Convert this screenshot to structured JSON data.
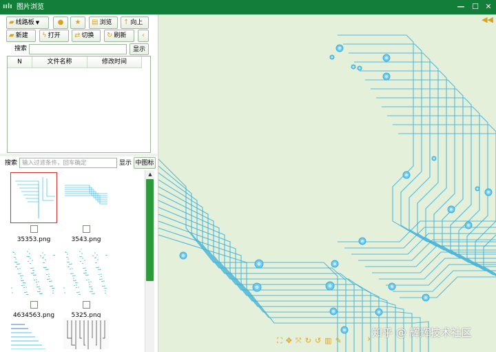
{
  "window": {
    "title": "图片浏览",
    "app_icon": "chart-bars-icon",
    "buttons": {
      "minimize": "—",
      "maximize": "☐",
      "close": "✕"
    },
    "colors": {
      "titlebar": "#137d3a",
      "viewer_bg": "#e5f0da",
      "accent": "#d9a21b",
      "circuit": "#3aaed8"
    }
  },
  "toolbar": {
    "folder_label": "线路板",
    "browse_label": "浏览",
    "up_label": "向上",
    "new_label": "新建",
    "open_label": "打开",
    "switch_label": "切换",
    "refresh_label": "刷新"
  },
  "search": {
    "label": "搜索",
    "value": "",
    "show_label": "显示"
  },
  "file_table": {
    "columns": [
      "N",
      "文件名称",
      "修改时间"
    ],
    "rows": []
  },
  "filter": {
    "label": "搜索",
    "placeholder": "输入过滤条件，回车确定",
    "show_label": "显示",
    "view_mode": "中图标"
  },
  "thumbnails": [
    {
      "name": "35353.png",
      "selected": true,
      "checked": false
    },
    {
      "name": "3543.png",
      "selected": false,
      "checked": false
    },
    {
      "name": "4634563.png",
      "selected": false,
      "checked": false
    },
    {
      "name": "5325.png",
      "selected": false,
      "checked": false
    },
    {
      "name": "",
      "selected": false,
      "checked": false
    },
    {
      "name": "",
      "selected": false,
      "checked": false
    }
  ],
  "viewer": {
    "watermark": "知乎 @ 辉辉技术社区",
    "tool_icons": [
      "fit-window-icon",
      "fit-grid-icon",
      "fullscreen-icon",
      "rotate-right-icon",
      "rotate-left-icon",
      "delete-icon",
      "edit-icon"
    ]
  }
}
